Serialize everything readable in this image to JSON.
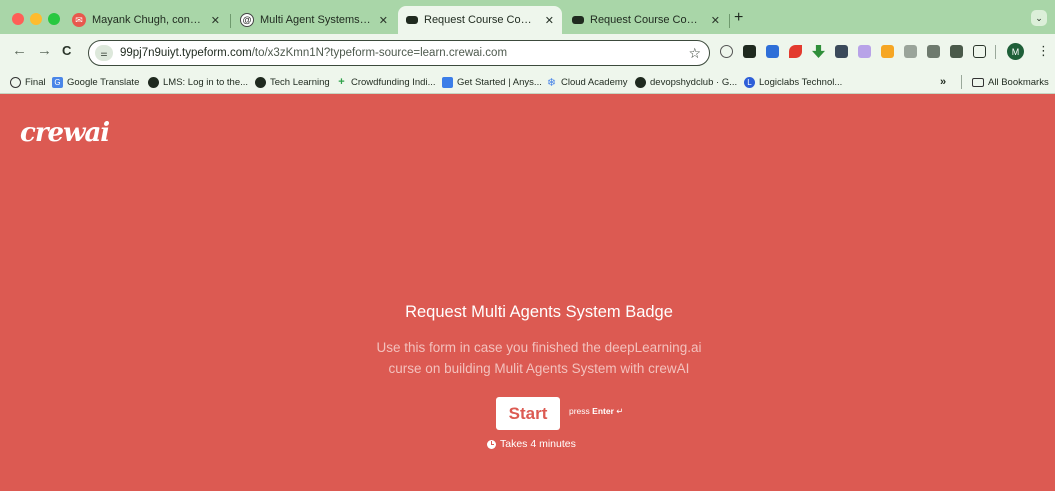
{
  "window": {
    "tabs": [
      {
        "title": "Mayank Chugh, congratulatio",
        "favicon": "envelope-icon",
        "active": false
      },
      {
        "title": "Multi Agent Systems and how",
        "favicon": "spiral-icon",
        "active": false
      },
      {
        "title": "Request Course Completion I",
        "favicon": "typeform-icon",
        "active": true
      },
      {
        "title": "Request Course Completion I",
        "favicon": "typeform-icon",
        "active": false
      }
    ],
    "close_glyph": "✕",
    "new_tab_glyph": "+",
    "tab_search_glyph": "⌄"
  },
  "toolbar": {
    "back_glyph": "←",
    "forward_glyph": "→",
    "reload_glyph": "C",
    "url_host": "99pj7n9uiyt.typeform.com",
    "url_path": "/to/x3zKmn1N?typeform-source=learn.crewai.com",
    "star_glyph": "☆",
    "profile_initial": "M",
    "menu_glyph": "⋮",
    "extension_glyphs": [
      "⊚",
      "▣",
      "N",
      "✦",
      "⬇",
      "■",
      "◆",
      "▬",
      "▥",
      "▤",
      "▨",
      "⟐"
    ]
  },
  "bookmarks": {
    "items": [
      {
        "label": "Final",
        "icon": "clock-icon"
      },
      {
        "label": "Google Translate",
        "icon": "translate-icon"
      },
      {
        "label": "LMS: Log in to the...",
        "icon": "globe-icon"
      },
      {
        "label": "Tech Learning",
        "icon": "globe-icon"
      },
      {
        "label": "Crowdfunding Indi...",
        "icon": "plus-icon"
      },
      {
        "label": "Get Started | Anys...",
        "icon": "grid-icon"
      },
      {
        "label": "Cloud Academy",
        "icon": "snowflake-icon"
      },
      {
        "label": "devopshydclub · G...",
        "icon": "github-icon"
      },
      {
        "label": "Logiclabs Technol...",
        "icon": "logiclabs-icon"
      }
    ],
    "overflow_glyph": "»",
    "all_bookmarks_label": "All Bookmarks"
  },
  "page": {
    "logo_text": "crewai",
    "title": "Request Multi Agents System Badge",
    "description_line1": "Use this form in case you finished the deepLearning.ai",
    "description_line2": "curse on building Mulit Agents System with crewAI",
    "start_label": "Start",
    "press_label": "press",
    "enter_key": "Enter",
    "enter_glyph": "↵",
    "time_label": "Takes 4 minutes"
  },
  "colors": {
    "page_background": "#dc5a52",
    "tabstrip": "#a9d6a8",
    "toolbar": "#eef6ec",
    "button_text": "#dc5a52"
  }
}
